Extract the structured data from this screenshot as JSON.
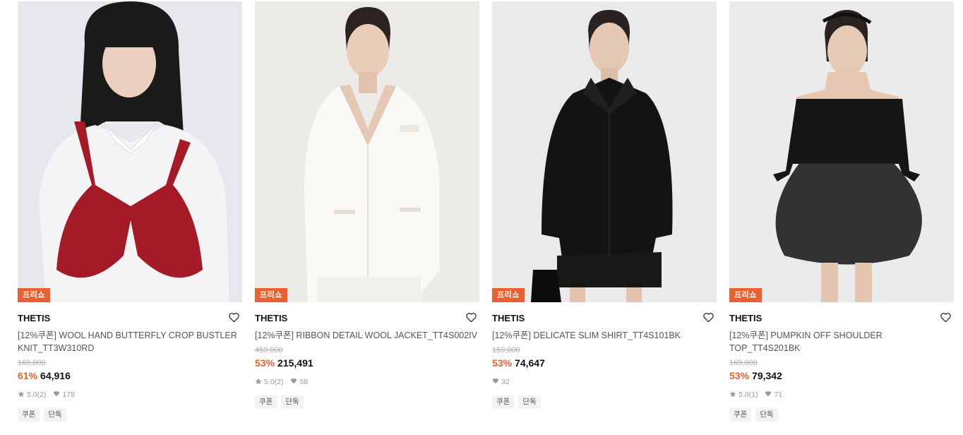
{
  "colors": {
    "accent": "#ec5f2e",
    "badge_bg": "#ec5f2e"
  },
  "products": [
    {
      "badge": "프리쇼",
      "brand": "THETIS",
      "title": "[12%쿠폰] WOOL HAND BUTTERFLY CROP BUSTLER KNIT_TT3W310RD",
      "original_price": "169,000",
      "discount": "61%",
      "price": "64,916",
      "rating": "5.0",
      "reviews": "(2)",
      "likes": "178",
      "tags": [
        "쿠폰",
        "단독"
      ],
      "wishlist_icon": "heart-outline-icon"
    },
    {
      "badge": "프리쇼",
      "brand": "THETIS",
      "title": "[12%쿠폰] RIBBON DETAIL WOOL JACKET_TT4S002IV",
      "original_price": "459,000",
      "discount": "53%",
      "price": "215,491",
      "rating": "5.0",
      "reviews": "(2)",
      "likes": "58",
      "tags": [
        "쿠폰",
        "단독"
      ],
      "wishlist_icon": "heart-outline-icon"
    },
    {
      "badge": "프리쇼",
      "brand": "THETIS",
      "title": "[12%쿠폰] DELICATE SLIM SHIRT_TT4S101BK",
      "original_price": "159,000",
      "discount": "53%",
      "price": "74,647",
      "likes": "32",
      "tags": [
        "쿠폰",
        "단독"
      ],
      "wishlist_icon": "heart-outline-icon"
    },
    {
      "badge": "프리쇼",
      "brand": "THETIS",
      "title": "[12%쿠폰] PUMPKIN OFF SHOULDER TOP_TT4S201BK",
      "original_price": "169,000",
      "discount": "53%",
      "price": "79,342",
      "rating": "5.0",
      "reviews": "(1)",
      "likes": "71",
      "tags": [
        "쿠폰",
        "단독"
      ],
      "wishlist_icon": "heart-outline-icon"
    }
  ]
}
